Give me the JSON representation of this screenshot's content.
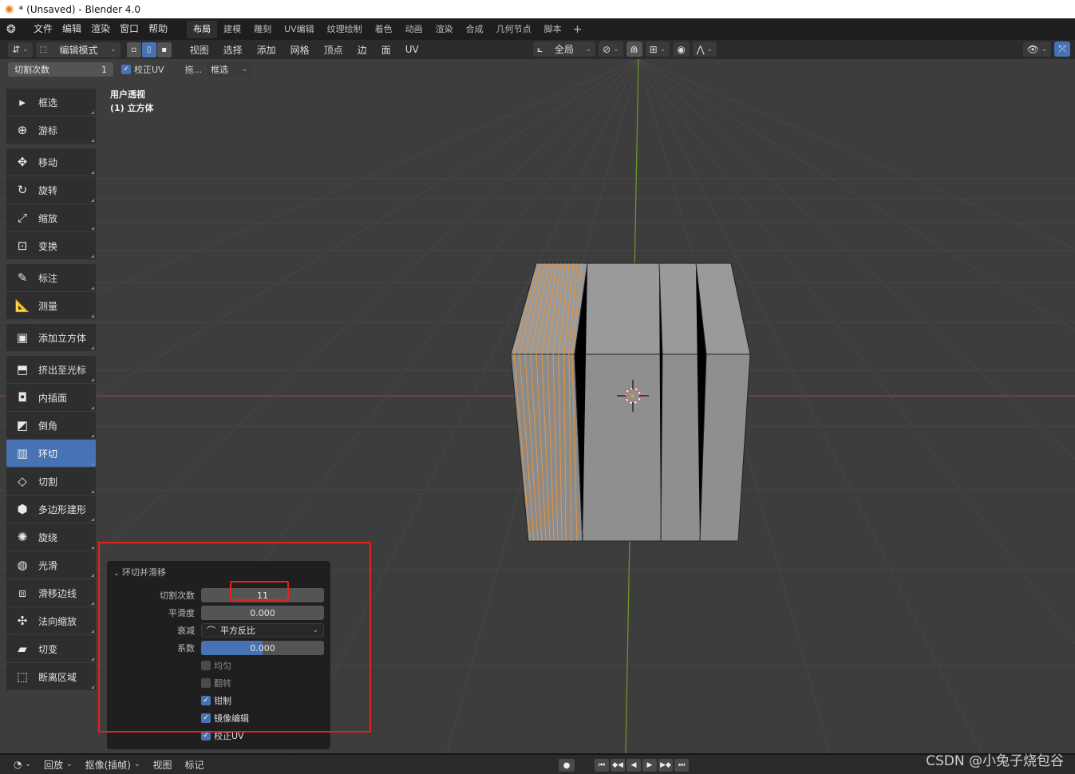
{
  "window": {
    "title": "* (Unsaved) - Blender 4.0"
  },
  "menubar": {
    "items": [
      "文件",
      "编辑",
      "渲染",
      "窗口",
      "帮助"
    ],
    "workspaces": [
      "布局",
      "建模",
      "雕刻",
      "UV编辑",
      "纹理绘制",
      "着色",
      "动画",
      "渲染",
      "合成",
      "几何节点",
      "脚本"
    ],
    "active_workspace": "布局",
    "add_workspace": "+"
  },
  "header": {
    "mode": "编辑模式",
    "menus": [
      "视图",
      "选择",
      "添加",
      "网格",
      "顶点",
      "边",
      "面",
      "UV"
    ],
    "transform_orientation": "全局"
  },
  "last_operator_bar": {
    "cuts_label": "切割次数",
    "cuts_value": "1",
    "correct_uv": "校正UV",
    "drag": "拖...",
    "select_box": "框选"
  },
  "viewport": {
    "view_name": "用户透视",
    "object_name": "(1) 立方体",
    "colors": {
      "background": "#3d3d3d",
      "x_axis": "#c63a3a",
      "y_axis": "#6f9a2b",
      "loop": "#e8953a"
    }
  },
  "toolbar": {
    "tools": [
      {
        "label": "框选",
        "icon": "select-box-icon",
        "glyph": "▸",
        "gap": false,
        "active": false
      },
      {
        "label": "游标",
        "icon": "cursor-icon",
        "glyph": "⊕",
        "gap": false,
        "active": false
      },
      {
        "label": "移动",
        "icon": "move-icon",
        "glyph": "✥",
        "gap": true,
        "active": false
      },
      {
        "label": "旋转",
        "icon": "rotate-icon",
        "glyph": "↻",
        "gap": false,
        "active": false
      },
      {
        "label": "缩放",
        "icon": "scale-icon",
        "glyph": "⤢",
        "gap": false,
        "active": false
      },
      {
        "label": "变换",
        "icon": "transform-icon",
        "glyph": "⊡",
        "gap": false,
        "active": false
      },
      {
        "label": "标注",
        "icon": "annotate-icon",
        "glyph": "✎",
        "gap": true,
        "active": false
      },
      {
        "label": "测量",
        "icon": "measure-icon",
        "glyph": "📐",
        "gap": false,
        "active": false
      },
      {
        "label": "添加立方体",
        "icon": "add-cube-icon",
        "glyph": "▣",
        "gap": true,
        "active": false
      },
      {
        "label": "挤出至光标",
        "icon": "extrude-cursor-icon",
        "glyph": "⬒",
        "gap": true,
        "active": false
      },
      {
        "label": "内插面",
        "icon": "inset-icon",
        "glyph": "◘",
        "gap": false,
        "active": false
      },
      {
        "label": "倒角",
        "icon": "bevel-icon",
        "glyph": "◩",
        "gap": false,
        "active": false
      },
      {
        "label": "环切",
        "icon": "loop-cut-icon",
        "glyph": "▥",
        "gap": false,
        "active": true
      },
      {
        "label": "切割",
        "icon": "knife-icon",
        "glyph": "◇",
        "gap": false,
        "active": false
      },
      {
        "label": "多边形建形",
        "icon": "poly-build-icon",
        "glyph": "⬢",
        "gap": false,
        "active": false
      },
      {
        "label": "旋绕",
        "icon": "spin-icon",
        "glyph": "✺",
        "gap": false,
        "active": false
      },
      {
        "label": "光滑",
        "icon": "smooth-icon",
        "glyph": "◍",
        "gap": false,
        "active": false
      },
      {
        "label": "滑移边线",
        "icon": "edge-slide-icon",
        "glyph": "⧈",
        "gap": false,
        "active": false
      },
      {
        "label": "法向缩放",
        "icon": "shrink-fatten-icon",
        "glyph": "✣",
        "gap": false,
        "active": false
      },
      {
        "label": "切变",
        "icon": "shear-icon",
        "glyph": "▰",
        "gap": false,
        "active": false
      },
      {
        "label": "断离区域",
        "icon": "rip-region-icon",
        "glyph": "⬚",
        "gap": false,
        "active": false
      }
    ]
  },
  "redo_panel": {
    "title": "环切并滑移",
    "number_of_cuts_label": "切割次数",
    "number_of_cuts": "11",
    "smoothness_label": "平滑度",
    "smoothness": "0.000",
    "falloff_label": "衰减",
    "falloff": "平方反比",
    "factor_label": "系数",
    "factor": "0.000",
    "factor_fill": 0.5,
    "even": "均匀",
    "flip": "翻转",
    "clamp": "钳制",
    "mirror_editing": "镜像编辑",
    "correct_uv": "校正UV"
  },
  "timeline": {
    "playback": "回放",
    "keying": "抠像(插帧)",
    "view": "视图",
    "marker": "标记"
  },
  "watermark": "CSDN @小兔子烧包谷"
}
